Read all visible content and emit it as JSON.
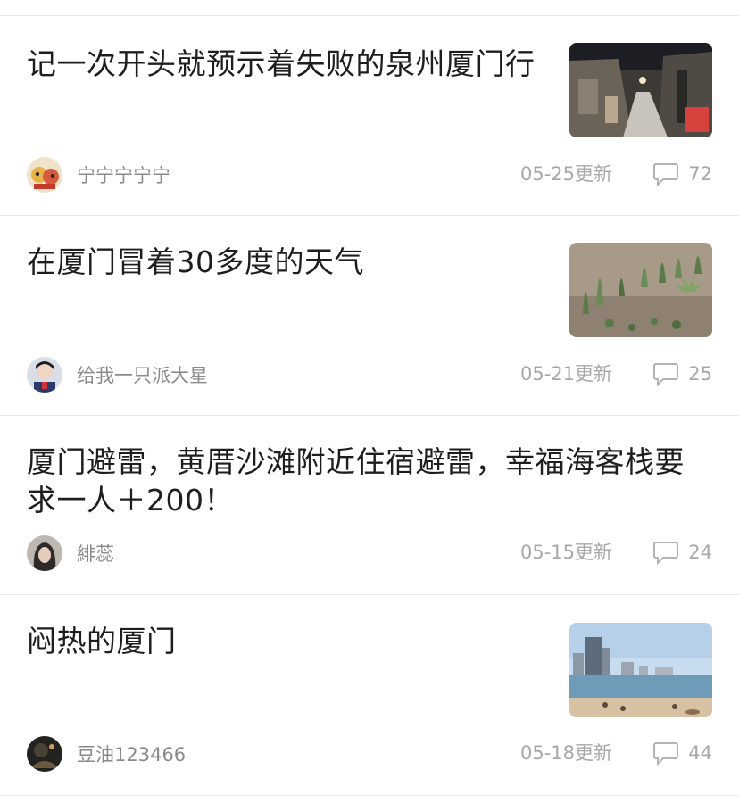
{
  "posts": [
    {
      "title": "记一次开头就预示着失败的泉州厦门行",
      "author": "宁宁宁宁宁",
      "updated": "05-25更新",
      "comments": "72",
      "thumbnail": "night-street-photo",
      "avatar": "cartoon-avatar"
    },
    {
      "title": "在厦门冒着30多度的天气",
      "author": "给我一只派大星",
      "updated": "05-21更新",
      "comments": "25",
      "thumbnail": "cactus-garden-photo",
      "avatar": "person-avatar"
    },
    {
      "title": "厦门避雷，黄厝沙滩附近住宿避雷，幸福海客栈要求一人＋200！",
      "author": "緋蕊",
      "updated": "05-15更新",
      "comments": "24",
      "avatar": "portrait-avatar"
    },
    {
      "title": "闷热的厦门",
      "author": "豆油123466",
      "updated": "05-18更新",
      "comments": "44",
      "thumbnail": "beach-skyline-photo",
      "avatar": "dark-avatar"
    }
  ],
  "colors": {
    "title": "#1e1e1e",
    "meta": "#a8a8a8",
    "divider": "#e8e8e8"
  }
}
